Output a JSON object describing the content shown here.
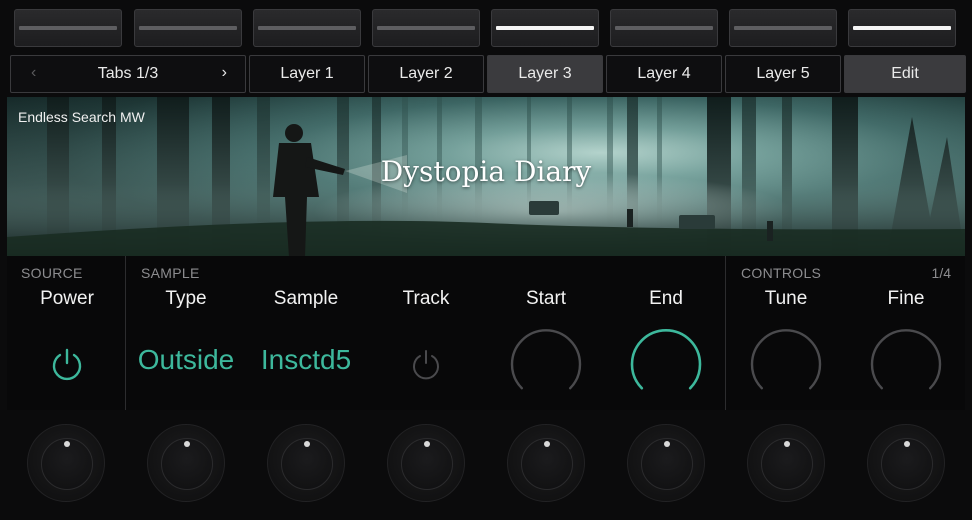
{
  "hardware_buttons": [
    {
      "name": "hw-button-1",
      "lit": false
    },
    {
      "name": "hw-button-2",
      "lit": false
    },
    {
      "name": "hw-button-3",
      "lit": false
    },
    {
      "name": "hw-button-4",
      "lit": false
    },
    {
      "name": "hw-button-5",
      "lit": true
    },
    {
      "name": "hw-button-6",
      "lit": false
    },
    {
      "name": "hw-button-7",
      "lit": false
    },
    {
      "name": "hw-button-8",
      "lit": true
    }
  ],
  "tabs": {
    "pager_label": "Tabs 1/3",
    "prev_icon": "chevron-left-icon",
    "next_icon": "chevron-right-icon",
    "items": [
      "Layer 1",
      "Layer 2",
      "Layer 3",
      "Layer 4",
      "Layer 5",
      "Edit"
    ],
    "active": "Layer 3"
  },
  "banner": {
    "brand": "Endless Search MW",
    "title": "Dystopia Diary"
  },
  "sections": {
    "source": "SOURCE",
    "sample": "SAMPLE",
    "controls": "CONTROLS",
    "controls_page": "1/4"
  },
  "params": [
    {
      "name": "Power",
      "kind": "power",
      "on": true
    },
    {
      "name": "Type",
      "kind": "text",
      "value": "Outside"
    },
    {
      "name": "Sample",
      "kind": "text",
      "value": "Insctd5"
    },
    {
      "name": "Track",
      "kind": "power",
      "on": false
    },
    {
      "name": "Start",
      "kind": "knob",
      "level": 0
    },
    {
      "name": "End",
      "kind": "knob",
      "level": 1
    },
    {
      "name": "Tune",
      "kind": "knob",
      "level": 0
    },
    {
      "name": "Fine",
      "kind": "knob",
      "level": 0
    }
  ],
  "colors": {
    "accent": "#3db89c",
    "inactive": "#4a4a4d",
    "led_on": "#f5f5f5",
    "led_off": "#5e5e61"
  }
}
